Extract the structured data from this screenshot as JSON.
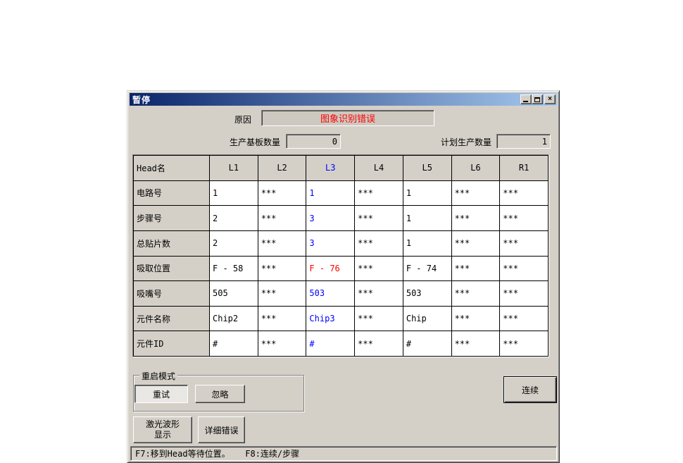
{
  "window": {
    "title": "暂停",
    "close_glyph": "×"
  },
  "reason": {
    "label": "原因",
    "value": "图象识别错误"
  },
  "counters": {
    "produced": {
      "label": "生产基板数量",
      "value": "0"
    },
    "planned": {
      "label": "计划生产数量",
      "value": "1"
    }
  },
  "table": {
    "corner": "Head名",
    "columns": [
      "L1",
      "L2",
      "L3",
      "L4",
      "L5",
      "L6",
      "R1"
    ],
    "column_colors": [
      "",
      "",
      "blue",
      "",
      "",
      "",
      ""
    ],
    "rows": [
      {
        "label": "电路号",
        "cells": [
          "1",
          "***",
          "1",
          "***",
          "1",
          "***",
          "***"
        ],
        "colors": [
          "",
          "",
          "blue",
          "",
          "",
          "",
          ""
        ]
      },
      {
        "label": "步骤号",
        "cells": [
          "2",
          "***",
          "3",
          "***",
          "1",
          "***",
          "***"
        ],
        "colors": [
          "",
          "",
          "blue",
          "",
          "",
          "",
          ""
        ]
      },
      {
        "label": "总贴片数",
        "cells": [
          "2",
          "***",
          "3",
          "***",
          "1",
          "***",
          "***"
        ],
        "colors": [
          "",
          "",
          "blue",
          "",
          "",
          "",
          ""
        ]
      },
      {
        "label": "吸取位置",
        "cells": [
          "F - 58",
          "***",
          "F - 76",
          "***",
          "F - 74",
          "***",
          "***"
        ],
        "colors": [
          "",
          "",
          "red",
          "",
          "",
          "",
          ""
        ]
      },
      {
        "label": "吸嘴号",
        "cells": [
          "505",
          "***",
          "503",
          "***",
          "503",
          "***",
          "***"
        ],
        "colors": [
          "",
          "",
          "blue",
          "",
          "",
          "",
          ""
        ]
      },
      {
        "label": "元件名称",
        "cells": [
          "Chip2",
          "***",
          "Chip3",
          "***",
          "Chip",
          "***",
          "***"
        ],
        "colors": [
          "",
          "",
          "blue",
          "",
          "",
          "",
          ""
        ]
      },
      {
        "label": "元件ID",
        "cells": [
          "#",
          "***",
          "#",
          "***",
          "#",
          "***",
          "***"
        ],
        "colors": [
          "",
          "",
          "blue",
          "",
          "",
          "",
          ""
        ]
      }
    ]
  },
  "restart": {
    "group_label": "重启模式",
    "retry_label": "重试",
    "ignore_label": "忽略"
  },
  "actions": {
    "continue_label": "连续",
    "laser_label": "激光波形\n显示",
    "detail_label": "详细错误"
  },
  "statusbar": {
    "text": "F7:移到Head等待位置。   F8:连续/步骤"
  },
  "colors": {
    "dialog_face": "#D4D0C8",
    "titlebar_left": "#0A246A",
    "titlebar_right": "#A6CAF0",
    "accent_blue": "#0000FF",
    "error_red": "#FF0000"
  }
}
